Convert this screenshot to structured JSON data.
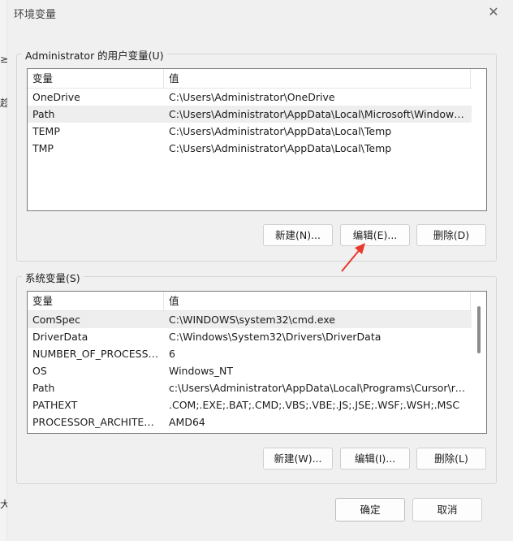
{
  "window": {
    "title": "环境变量",
    "close_glyph": "✕"
  },
  "background": {
    "marks": [
      "≥",
      "趁",
      "大"
    ]
  },
  "user_vars": {
    "group_label": "Administrator 的用户变量(U)",
    "columns": [
      "变量",
      "值"
    ],
    "rows": [
      {
        "name": "OneDrive",
        "value": "C:\\Users\\Administrator\\OneDrive"
      },
      {
        "name": "Path",
        "value": "C:\\Users\\Administrator\\AppData\\Local\\Microsoft\\WindowsA...",
        "selected": true
      },
      {
        "name": "TEMP",
        "value": "C:\\Users\\Administrator\\AppData\\Local\\Temp"
      },
      {
        "name": "TMP",
        "value": "C:\\Users\\Administrator\\AppData\\Local\\Temp"
      }
    ],
    "buttons": {
      "new": "新建(N)...",
      "edit": "编辑(E)...",
      "delete": "删除(D)"
    }
  },
  "system_vars": {
    "group_label": "系统变量(S)",
    "columns": [
      "变量",
      "值"
    ],
    "rows": [
      {
        "name": "ComSpec",
        "value": "C:\\WINDOWS\\system32\\cmd.exe",
        "selected": true
      },
      {
        "name": "DriverData",
        "value": "C:\\Windows\\System32\\Drivers\\DriverData"
      },
      {
        "name": "NUMBER_OF_PROCESSORS",
        "value": "6"
      },
      {
        "name": "OS",
        "value": "Windows_NT"
      },
      {
        "name": "Path",
        "value": "c:\\Users\\Administrator\\AppData\\Local\\Programs\\Cursor\\res..."
      },
      {
        "name": "PATHEXT",
        "value": ".COM;.EXE;.BAT;.CMD;.VBS;.VBE;.JS;.JSE;.WSF;.WSH;.MSC"
      },
      {
        "name": "PROCESSOR_ARCHITECT...",
        "value": "AMD64"
      }
    ],
    "buttons": {
      "new": "新建(W)...",
      "edit": "编辑(I)...",
      "delete": "删除(L)"
    }
  },
  "footer": {
    "ok": "确定",
    "cancel": "取消"
  },
  "colors": {
    "annotation_arrow": "#e8392b",
    "selected_row": "#eeeeee"
  }
}
